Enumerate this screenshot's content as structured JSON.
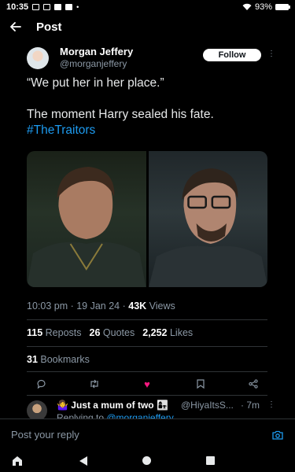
{
  "status_bar": {
    "time": "10:35",
    "battery": "93%"
  },
  "header": {
    "back_icon": "arrow-left-icon",
    "title": "Post"
  },
  "tweet": {
    "author_name": "Morgan Jeffery",
    "author_handle": "@morganjeffery",
    "follow_label": "Follow",
    "text_line_1": "“We put her in her place.”",
    "text_line_2": "The moment Harry sealed his fate.",
    "hashtag": "#TheTraitors",
    "timestamp": "10:03 pm · 19 Jan 24 · ",
    "views_count": "43K",
    "views_label": " Views",
    "reposts_count": "115",
    "reposts_label": "Reposts",
    "quotes_count": "26",
    "quotes_label": "Quotes",
    "likes_count": "2,252",
    "likes_label": "Likes",
    "bookmarks_count": "31",
    "bookmarks_label": "Bookmarks",
    "accent_color": "#1d9bf0",
    "like_color": "#f91880"
  },
  "reply": {
    "name": "🤷‍♀️ Just a mum of two 👩‍👧",
    "handle": "@HiyaItsS...",
    "time": "· 7m",
    "replying_to_prefix": "Replying to ",
    "replying_to_handle": "@morganjeffery"
  },
  "composer": {
    "placeholder": "Post your reply"
  }
}
